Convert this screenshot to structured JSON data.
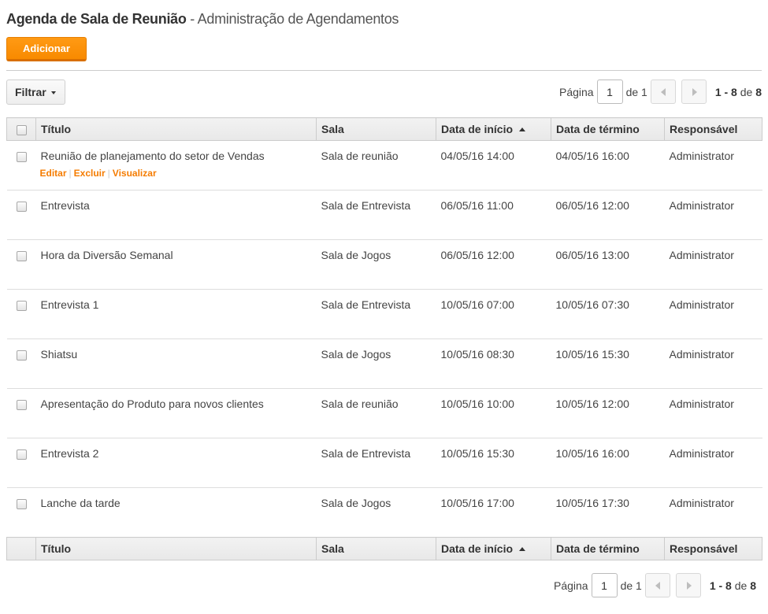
{
  "header": {
    "title": "Agenda de Sala de Reunião",
    "separator": " - ",
    "subtitle": "Administração de Agendamentos"
  },
  "toolbar": {
    "add_label": "Adicionar",
    "filter_label": "Filtrar"
  },
  "pager_top": {
    "page_label": "Página",
    "page_value": "1",
    "of_label": "de 1",
    "range_start_end": "1 - 8",
    "range_of": " de ",
    "range_total": "8"
  },
  "pager_bottom": {
    "page_label": "Página",
    "page_value": "1",
    "of_label": "de 1",
    "range_start_end": "1 - 8",
    "range_of": " de ",
    "range_total": "8"
  },
  "table": {
    "columns": [
      "Título",
      "Sala",
      "Data de início",
      "Data de término",
      "Responsável"
    ],
    "row_actions": {
      "edit": "Editar",
      "delete": "Excluir",
      "view": "Visualizar",
      "separator": "|"
    },
    "rows": [
      {
        "title": "Reunião de planejamento do setor de Vendas",
        "room": "Sala de reunião",
        "start": "04/05/16 14:00",
        "end": "04/05/16 16:00",
        "owner": "Administrator"
      },
      {
        "title": "Entrevista",
        "room": "Sala de Entrevista",
        "start": "06/05/16 11:00",
        "end": "06/05/16 12:00",
        "owner": "Administrator"
      },
      {
        "title": "Hora da Diversão Semanal",
        "room": "Sala de Jogos",
        "start": "06/05/16 12:00",
        "end": "06/05/16 13:00",
        "owner": "Administrator"
      },
      {
        "title": "Entrevista 1",
        "room": "Sala de Entrevista",
        "start": "10/05/16 07:00",
        "end": "10/05/16 07:30",
        "owner": "Administrator"
      },
      {
        "title": "Shiatsu",
        "room": "Sala de Jogos",
        "start": "10/05/16 08:30",
        "end": "10/05/16 15:30",
        "owner": "Administrator"
      },
      {
        "title": "Apresentação do Produto para novos clientes",
        "room": "Sala de reunião",
        "start": "10/05/16 10:00",
        "end": "10/05/16 12:00",
        "owner": "Administrator"
      },
      {
        "title": "Entrevista 2",
        "room": "Sala de Entrevista",
        "start": "10/05/16 15:30",
        "end": "10/05/16 16:00",
        "owner": "Administrator"
      },
      {
        "title": "Lanche da tarde",
        "room": "Sala de Jogos",
        "start": "10/05/16 17:00",
        "end": "10/05/16 17:30",
        "owner": "Administrator"
      }
    ]
  },
  "colors": {
    "accent": "#ff8f00",
    "link": "#f57c00"
  },
  "icons": {
    "filter_caret": "caret-down-icon",
    "sort": "sort-ascending-icon",
    "prev": "prev-page-icon",
    "next": "next-page-icon"
  }
}
